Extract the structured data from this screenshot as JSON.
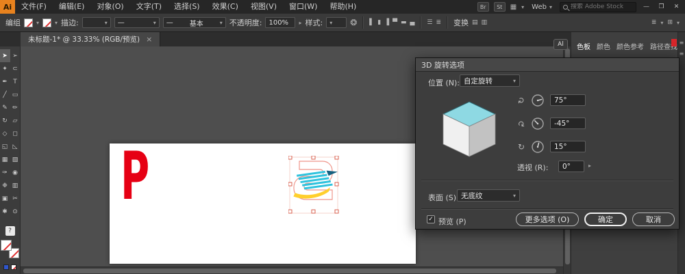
{
  "icons": {
    "chevron_down": "▾",
    "chevron_right": "▸",
    "check": "✓",
    "close": "✕",
    "minimize": "—",
    "restore": "❐",
    "tab_close": "×",
    "line": "—",
    "recolor": "❂",
    "layout": "▦"
  },
  "app": {
    "logo": "Ai"
  },
  "menubar": {
    "items": [
      "文件(F)",
      "编辑(E)",
      "对象(O)",
      "文字(T)",
      "选择(S)",
      "效果(C)",
      "视图(V)",
      "窗口(W)",
      "帮助(H)"
    ],
    "br_badge": "Br",
    "st_badge": "St",
    "web_label": "Web",
    "search_placeholder": "搜索 Adobe Stock"
  },
  "controlbar": {
    "selection_label": "编组",
    "stroke_label": "描边:",
    "brush_value": "基本",
    "opacity_label": "不透明度:",
    "opacity_value": "100%",
    "style_label": "样式:",
    "transform_label": "变换",
    "align_icons": [
      "▌",
      "▮",
      "▐",
      "▀",
      "▬",
      "▄"
    ],
    "distribute_icons": [
      "☰",
      "≣"
    ],
    "arrange_icons": [
      "▤",
      "▥"
    ],
    "right_icons": [
      "≣",
      "▾",
      "⊞",
      "▾"
    ]
  },
  "tabbar": {
    "title": "未标题-1* @ 33.33% (RGB/预览)"
  },
  "toolbar": {
    "unknown_badge": "?",
    "tools": [
      {
        "name": "selection-tool",
        "glyph": "➤"
      },
      {
        "name": "direct-selection-tool",
        "glyph": "➢"
      },
      {
        "name": "magic-wand-tool",
        "glyph": "✦"
      },
      {
        "name": "lasso-tool",
        "glyph": "⊂"
      },
      {
        "name": "pen-tool",
        "glyph": "✒"
      },
      {
        "name": "type-tool",
        "glyph": "T"
      },
      {
        "name": "line-segment-tool",
        "glyph": "╱"
      },
      {
        "name": "rectangle-tool",
        "glyph": "▭"
      },
      {
        "name": "paintbrush-tool",
        "glyph": "✎"
      },
      {
        "name": "pencil-tool",
        "glyph": "✏"
      },
      {
        "name": "rotate-tool",
        "glyph": "↻"
      },
      {
        "name": "scale-tool",
        "glyph": "▱"
      },
      {
        "name": "width-tool",
        "glyph": "◇"
      },
      {
        "name": "free-transform-tool",
        "glyph": "◻"
      },
      {
        "name": "shape-builder-tool",
        "glyph": "◱"
      },
      {
        "name": "perspective-grid-tool",
        "glyph": "◺"
      },
      {
        "name": "mesh-tool",
        "glyph": "▦"
      },
      {
        "name": "gradient-tool",
        "glyph": "▧"
      },
      {
        "name": "eyedropper-tool",
        "glyph": "✑"
      },
      {
        "name": "blend-tool",
        "glyph": "◉"
      },
      {
        "name": "symbol-sprayer-tool",
        "glyph": "❉"
      },
      {
        "name": "column-graph-tool",
        "glyph": "▥"
      },
      {
        "name": "artboard-tool",
        "glyph": "▣"
      },
      {
        "name": "slice-tool",
        "glyph": "✂"
      },
      {
        "name": "hand-tool",
        "glyph": "✱"
      },
      {
        "name": "zoom-tool",
        "glyph": "⊙"
      }
    ]
  },
  "canvas": {
    "artboard_letter": "P"
  },
  "dock": {
    "ai_badge": "Al",
    "tabs": [
      "色板",
      "颜色",
      "颜色参考",
      "路径查找"
    ],
    "edge_icons": [
      "≡",
      "≡"
    ]
  },
  "dialog": {
    "title": "3D 旋转选项",
    "position_label": "位置 (N):",
    "position_value": "自定旋转",
    "rotate_x_value": "75°",
    "rotate_y_value": "-45°",
    "rotate_z_value": "15°",
    "perspective_label": "透视 (R):",
    "perspective_value": "0°",
    "surface_label": "表面 (S):",
    "surface_value": "无底纹",
    "preview_label": "预览 (P)",
    "more_options_button": "更多选项 (O)",
    "ok_button": "确定",
    "cancel_button": "取消"
  },
  "colors": {
    "logo_orange": "#e8821e",
    "letter_red": "#e60014",
    "cube_top_cyan": "#8ed9e3",
    "stripe_cyan": "#2fc3de",
    "swash_yellow": "#ffcf2d",
    "selection_handle_red": "#d9604f"
  }
}
